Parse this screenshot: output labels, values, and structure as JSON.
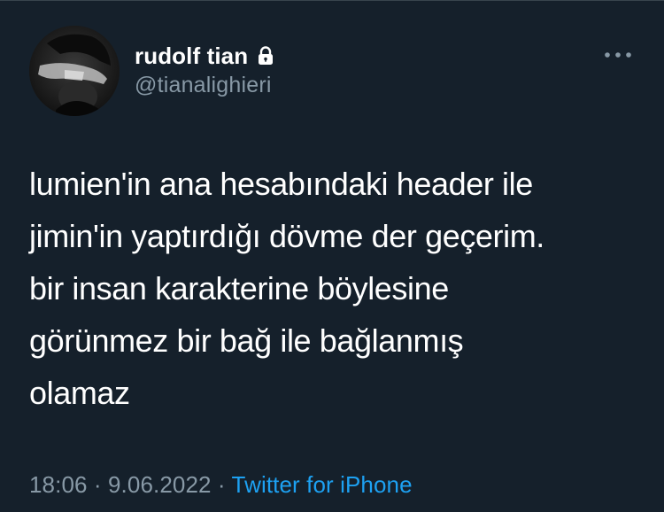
{
  "tweet": {
    "display_name": "rudolf tian",
    "handle": "@tianalighieri",
    "lines": [
      "lumien'in ana hesabındaki header ile",
      "jimin'in yaptırdığı dövme der geçerim.",
      "bir insan karakterine böylesine",
      "görünmez bir bağ ile bağlanmış",
      "olamaz"
    ],
    "time": "18:06",
    "date": "9.06.2022",
    "separator": "·",
    "source": "Twitter for iPhone"
  },
  "icons": {
    "lock": "lock-icon",
    "more": "more-horizontal-icon",
    "avatar": "profile-photo"
  },
  "colors": {
    "background": "#15202b",
    "text": "#ffffff",
    "secondary_text": "#8899a6",
    "link": "#1da1f2"
  }
}
